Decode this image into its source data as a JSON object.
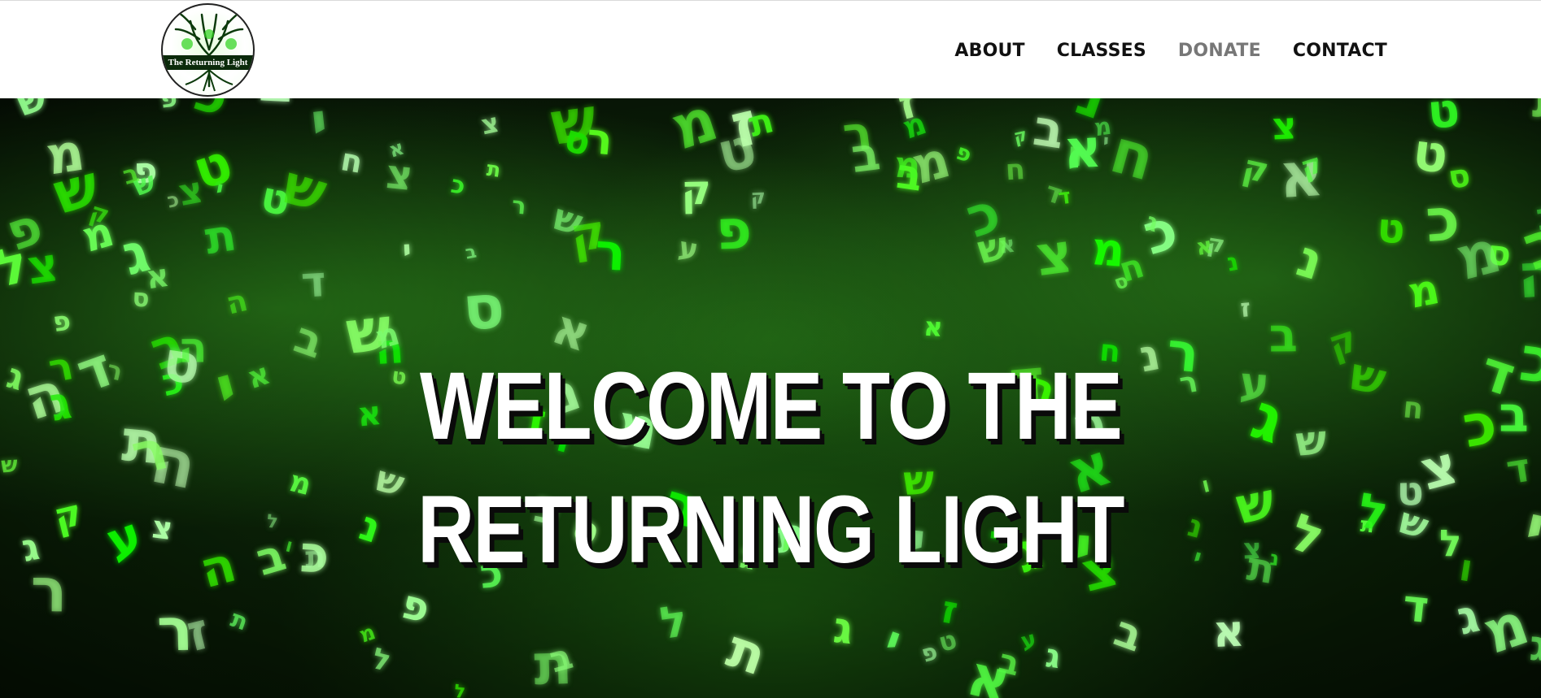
{
  "header": {
    "logo_text": "The Returning Light",
    "logo_icon": "tree-of-life-icon",
    "nav": [
      {
        "label": "ABOUT",
        "state": "normal"
      },
      {
        "label": "CLASSES",
        "state": "normal"
      },
      {
        "label": "DONATE",
        "state": "muted"
      },
      {
        "label": "CONTACT",
        "state": "normal"
      }
    ]
  },
  "hero": {
    "title_line1": "WELCOME TO THE",
    "title_line2": "RETURNING LIGHT",
    "background_icon": "glowing-hebrew-letters-image"
  },
  "colors": {
    "nav_text": "#111111",
    "nav_muted": "#777777",
    "hero_green": "#39ff14",
    "headline": "#ffffff"
  }
}
